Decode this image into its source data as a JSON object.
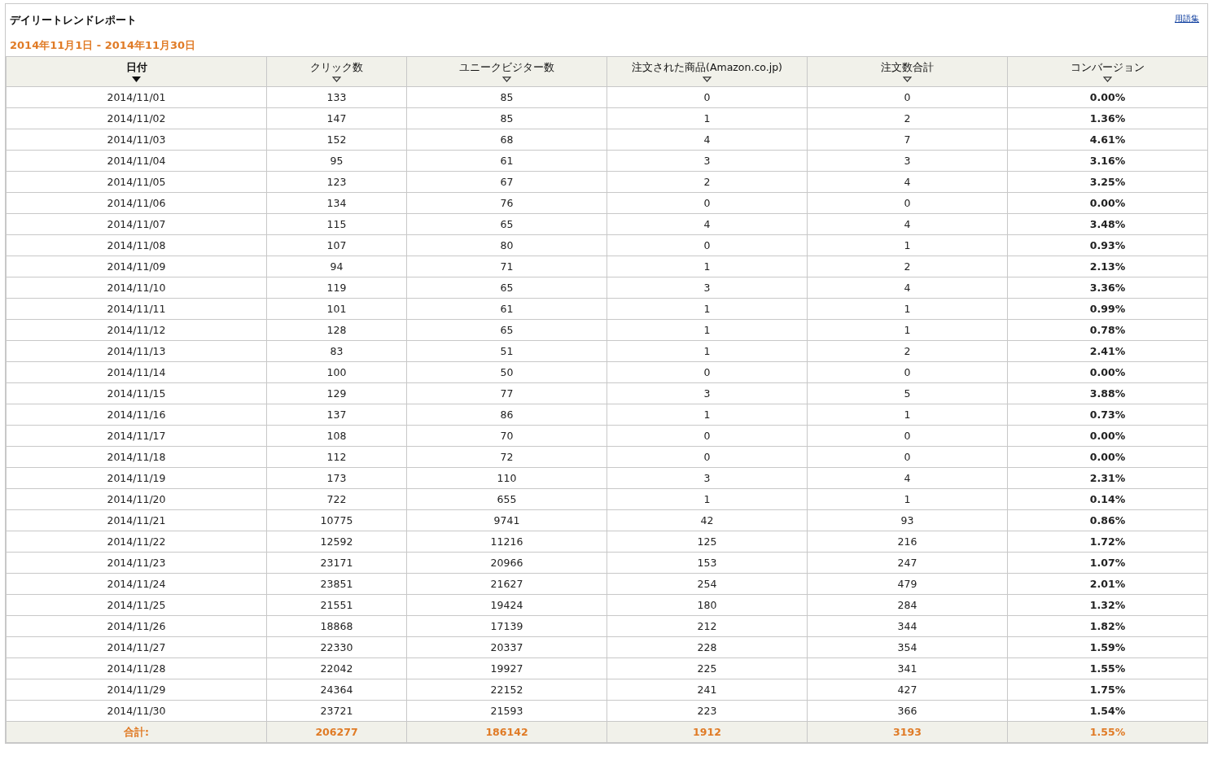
{
  "report": {
    "title": "デイリートレンドレポート",
    "period": "2014年11月1日 - 2014年11月30日",
    "glossary_link": "用語集"
  },
  "table": {
    "columns": [
      {
        "label": "日付",
        "sorted": true
      },
      {
        "label": "クリック数",
        "sorted": false
      },
      {
        "label": "ユニークビジター数",
        "sorted": false
      },
      {
        "label": "注文された商品(Amazon.co.jp)",
        "sorted": false
      },
      {
        "label": "注文数合計",
        "sorted": false
      },
      {
        "label": "コンバージョン",
        "sorted": false
      }
    ],
    "rows": [
      [
        "2014/11/01",
        "133",
        "85",
        "0",
        "0",
        "0.00%"
      ],
      [
        "2014/11/02",
        "147",
        "85",
        "1",
        "2",
        "1.36%"
      ],
      [
        "2014/11/03",
        "152",
        "68",
        "4",
        "7",
        "4.61%"
      ],
      [
        "2014/11/04",
        "95",
        "61",
        "3",
        "3",
        "3.16%"
      ],
      [
        "2014/11/05",
        "123",
        "67",
        "2",
        "4",
        "3.25%"
      ],
      [
        "2014/11/06",
        "134",
        "76",
        "0",
        "0",
        "0.00%"
      ],
      [
        "2014/11/07",
        "115",
        "65",
        "4",
        "4",
        "3.48%"
      ],
      [
        "2014/11/08",
        "107",
        "80",
        "0",
        "1",
        "0.93%"
      ],
      [
        "2014/11/09",
        "94",
        "71",
        "1",
        "2",
        "2.13%"
      ],
      [
        "2014/11/10",
        "119",
        "65",
        "3",
        "4",
        "3.36%"
      ],
      [
        "2014/11/11",
        "101",
        "61",
        "1",
        "1",
        "0.99%"
      ],
      [
        "2014/11/12",
        "128",
        "65",
        "1",
        "1",
        "0.78%"
      ],
      [
        "2014/11/13",
        "83",
        "51",
        "1",
        "2",
        "2.41%"
      ],
      [
        "2014/11/14",
        "100",
        "50",
        "0",
        "0",
        "0.00%"
      ],
      [
        "2014/11/15",
        "129",
        "77",
        "3",
        "5",
        "3.88%"
      ],
      [
        "2014/11/16",
        "137",
        "86",
        "1",
        "1",
        "0.73%"
      ],
      [
        "2014/11/17",
        "108",
        "70",
        "0",
        "0",
        "0.00%"
      ],
      [
        "2014/11/18",
        "112",
        "72",
        "0",
        "0",
        "0.00%"
      ],
      [
        "2014/11/19",
        "173",
        "110",
        "3",
        "4",
        "2.31%"
      ],
      [
        "2014/11/20",
        "722",
        "655",
        "1",
        "1",
        "0.14%"
      ],
      [
        "2014/11/21",
        "10775",
        "9741",
        "42",
        "93",
        "0.86%"
      ],
      [
        "2014/11/22",
        "12592",
        "11216",
        "125",
        "216",
        "1.72%"
      ],
      [
        "2014/11/23",
        "23171",
        "20966",
        "153",
        "247",
        "1.07%"
      ],
      [
        "2014/11/24",
        "23851",
        "21627",
        "254",
        "479",
        "2.01%"
      ],
      [
        "2014/11/25",
        "21551",
        "19424",
        "180",
        "284",
        "1.32%"
      ],
      [
        "2014/11/26",
        "18868",
        "17139",
        "212",
        "344",
        "1.82%"
      ],
      [
        "2014/11/27",
        "22330",
        "20337",
        "228",
        "354",
        "1.59%"
      ],
      [
        "2014/11/28",
        "22042",
        "19927",
        "225",
        "341",
        "1.55%"
      ],
      [
        "2014/11/29",
        "24364",
        "22152",
        "241",
        "427",
        "1.75%"
      ],
      [
        "2014/11/30",
        "23721",
        "21593",
        "223",
        "366",
        "1.54%"
      ]
    ],
    "total": [
      "合計:",
      "206277",
      "186142",
      "1912",
      "3193",
      "1.55%"
    ]
  }
}
